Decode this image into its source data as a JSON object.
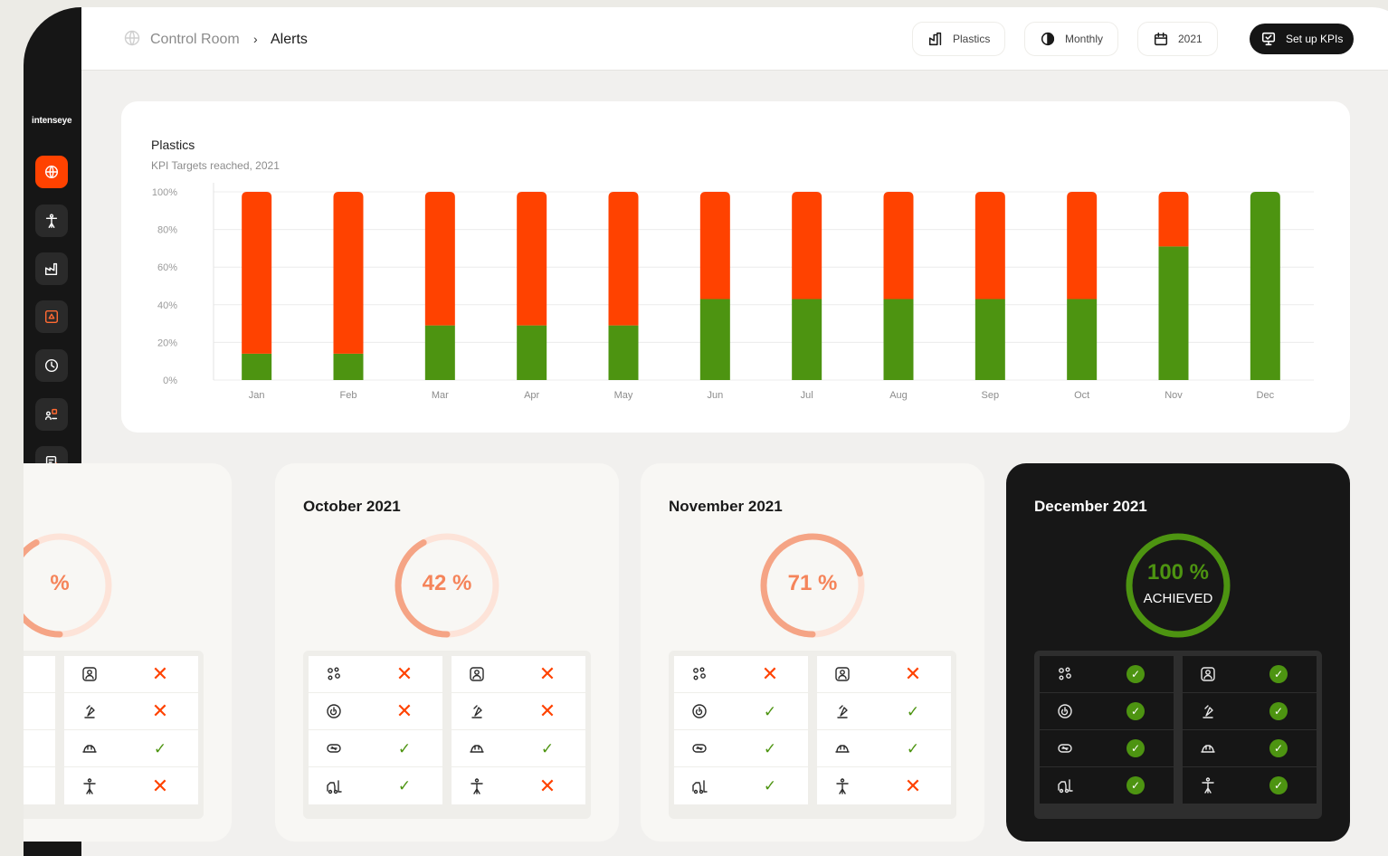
{
  "app": {
    "logo": "intenseye"
  },
  "breadcrumb": {
    "root": "Control Room",
    "separator": "›",
    "current": "Alerts"
  },
  "filters": {
    "site": "Plastics",
    "period": "Monthly",
    "year": "2021",
    "setup_label": "Set up KPIs"
  },
  "colors": {
    "accent": "#ff4200",
    "success": "#4d9411",
    "gauge": "#f5845a"
  },
  "chart_data": {
    "type": "bar",
    "stacked": true,
    "title": "Plastics",
    "subtitle": "KPI Targets reached, 2021",
    "categories": [
      "Jan",
      "Feb",
      "Mar",
      "Apr",
      "May",
      "Jun",
      "Jul",
      "Aug",
      "Sep",
      "Oct",
      "Nov",
      "Dec"
    ],
    "series": [
      {
        "color": "#4d9411",
        "values": [
          14,
          14,
          29,
          29,
          29,
          43,
          43,
          43,
          43,
          43,
          71,
          100
        ]
      },
      {
        "color": "#ff4200",
        "values": [
          86,
          86,
          71,
          71,
          71,
          57,
          57,
          57,
          57,
          57,
          29,
          0
        ]
      }
    ],
    "yticks": [
      "0%",
      "20%",
      "40%",
      "60%",
      "80%",
      "100%"
    ],
    "ylim": [
      0,
      100
    ],
    "grid": true
  },
  "months": [
    {
      "title": "",
      "value_text": "%",
      "percent": 42,
      "left": [
        "fail",
        "fail",
        "ok",
        "fail"
      ],
      "right": [
        "fail",
        "fail",
        "ok",
        "fail"
      ]
    },
    {
      "title": "October 2021",
      "value_text": "42 %",
      "percent": 42,
      "left": [
        "fail",
        "fail",
        "ok",
        "ok"
      ],
      "right": [
        "fail",
        "fail",
        "ok",
        "fail"
      ]
    },
    {
      "title": "November 2021",
      "value_text": "71 %",
      "percent": 71,
      "left": [
        "fail",
        "ok",
        "ok",
        "ok"
      ],
      "right": [
        "fail",
        "ok",
        "ok",
        "fail"
      ]
    },
    {
      "title": "December 2021",
      "value_text": "100 %",
      "sub_text": "ACHIEVED",
      "percent": 100,
      "left": [
        "ok",
        "ok",
        "ok",
        "ok"
      ],
      "right": [
        "ok",
        "ok",
        "ok",
        "ok"
      ]
    }
  ],
  "kpi_icons": {
    "left": [
      "people-group-icon",
      "target-icon",
      "hazard-icon",
      "forklift-icon"
    ],
    "right": [
      "person-badge-icon",
      "fire-extinguisher-icon",
      "hardhat-icon",
      "person-icon"
    ]
  }
}
